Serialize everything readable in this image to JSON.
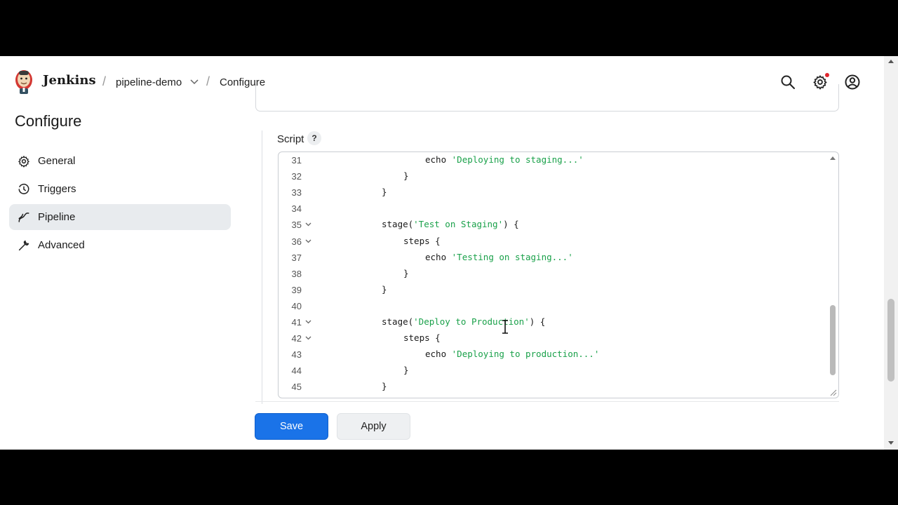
{
  "header": {
    "brand": "Jenkins",
    "breadcrumb_job": "pipeline-demo",
    "breadcrumb_page": "Configure",
    "separator": "/"
  },
  "sidebar": {
    "title": "Configure",
    "items": [
      {
        "label": "General",
        "icon": "gear-icon"
      },
      {
        "label": "Triggers",
        "icon": "clock-icon"
      },
      {
        "label": "Pipeline",
        "icon": "pipeline-icon",
        "active": true
      },
      {
        "label": "Advanced",
        "icon": "wrench-icon"
      }
    ]
  },
  "script": {
    "label": "Script",
    "help": "?",
    "lines": [
      {
        "n": "31",
        "indent": 3,
        "pre": "echo ",
        "str": "'Deploying to staging...'",
        "post": ""
      },
      {
        "n": "32",
        "indent": 2,
        "pre": "}",
        "str": "",
        "post": ""
      },
      {
        "n": "33",
        "indent": 1,
        "pre": "}",
        "str": "",
        "post": ""
      },
      {
        "n": "34",
        "indent": 0,
        "pre": "",
        "str": "",
        "post": ""
      },
      {
        "n": "35",
        "indent": 1,
        "pre": "stage(",
        "str": "'Test on Staging'",
        "post": ") {",
        "fold": true
      },
      {
        "n": "36",
        "indent": 2,
        "pre": "steps {",
        "str": "",
        "post": "",
        "fold": true
      },
      {
        "n": "37",
        "indent": 3,
        "pre": "echo ",
        "str": "'Testing on staging...'",
        "post": ""
      },
      {
        "n": "38",
        "indent": 2,
        "pre": "}",
        "str": "",
        "post": ""
      },
      {
        "n": "39",
        "indent": 1,
        "pre": "}",
        "str": "",
        "post": ""
      },
      {
        "n": "40",
        "indent": 0,
        "pre": "",
        "str": "",
        "post": ""
      },
      {
        "n": "41",
        "indent": 1,
        "pre": "stage(",
        "str": "'Deploy to Production'",
        "post": ") {",
        "fold": true
      },
      {
        "n": "42",
        "indent": 2,
        "pre": "steps {",
        "str": "",
        "post": "",
        "fold": true
      },
      {
        "n": "43",
        "indent": 3,
        "pre": "echo ",
        "str": "'Deploying to production...'",
        "post": ""
      },
      {
        "n": "44",
        "indent": 2,
        "pre": "}",
        "str": "",
        "post": ""
      },
      {
        "n": "45",
        "indent": 1,
        "pre": "}",
        "str": "",
        "post": ""
      }
    ]
  },
  "buttons": {
    "save": "Save",
    "apply": "Apply"
  },
  "colors": {
    "primary": "#1a73e8",
    "string": "#1aa14a",
    "notification": "#e0262d"
  }
}
